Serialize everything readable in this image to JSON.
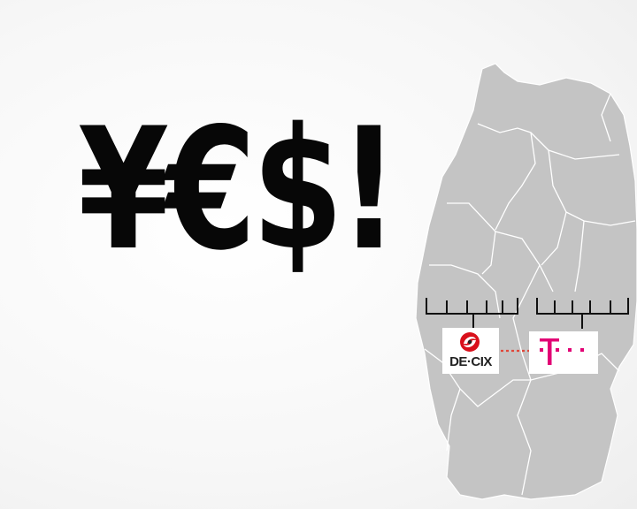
{
  "slide": {
    "headline": "¥€$!",
    "left_logo": {
      "text": "DE·CIX",
      "accent_color": "#d9101b"
    },
    "right_logo": {
      "name": "telekom-t-logo",
      "color": "#e20074"
    },
    "connection_color": "#e0473a",
    "map_fill_color": "#c4c4c4",
    "map_border_color": "#ffffff",
    "background_color": "#f6f6f6"
  }
}
